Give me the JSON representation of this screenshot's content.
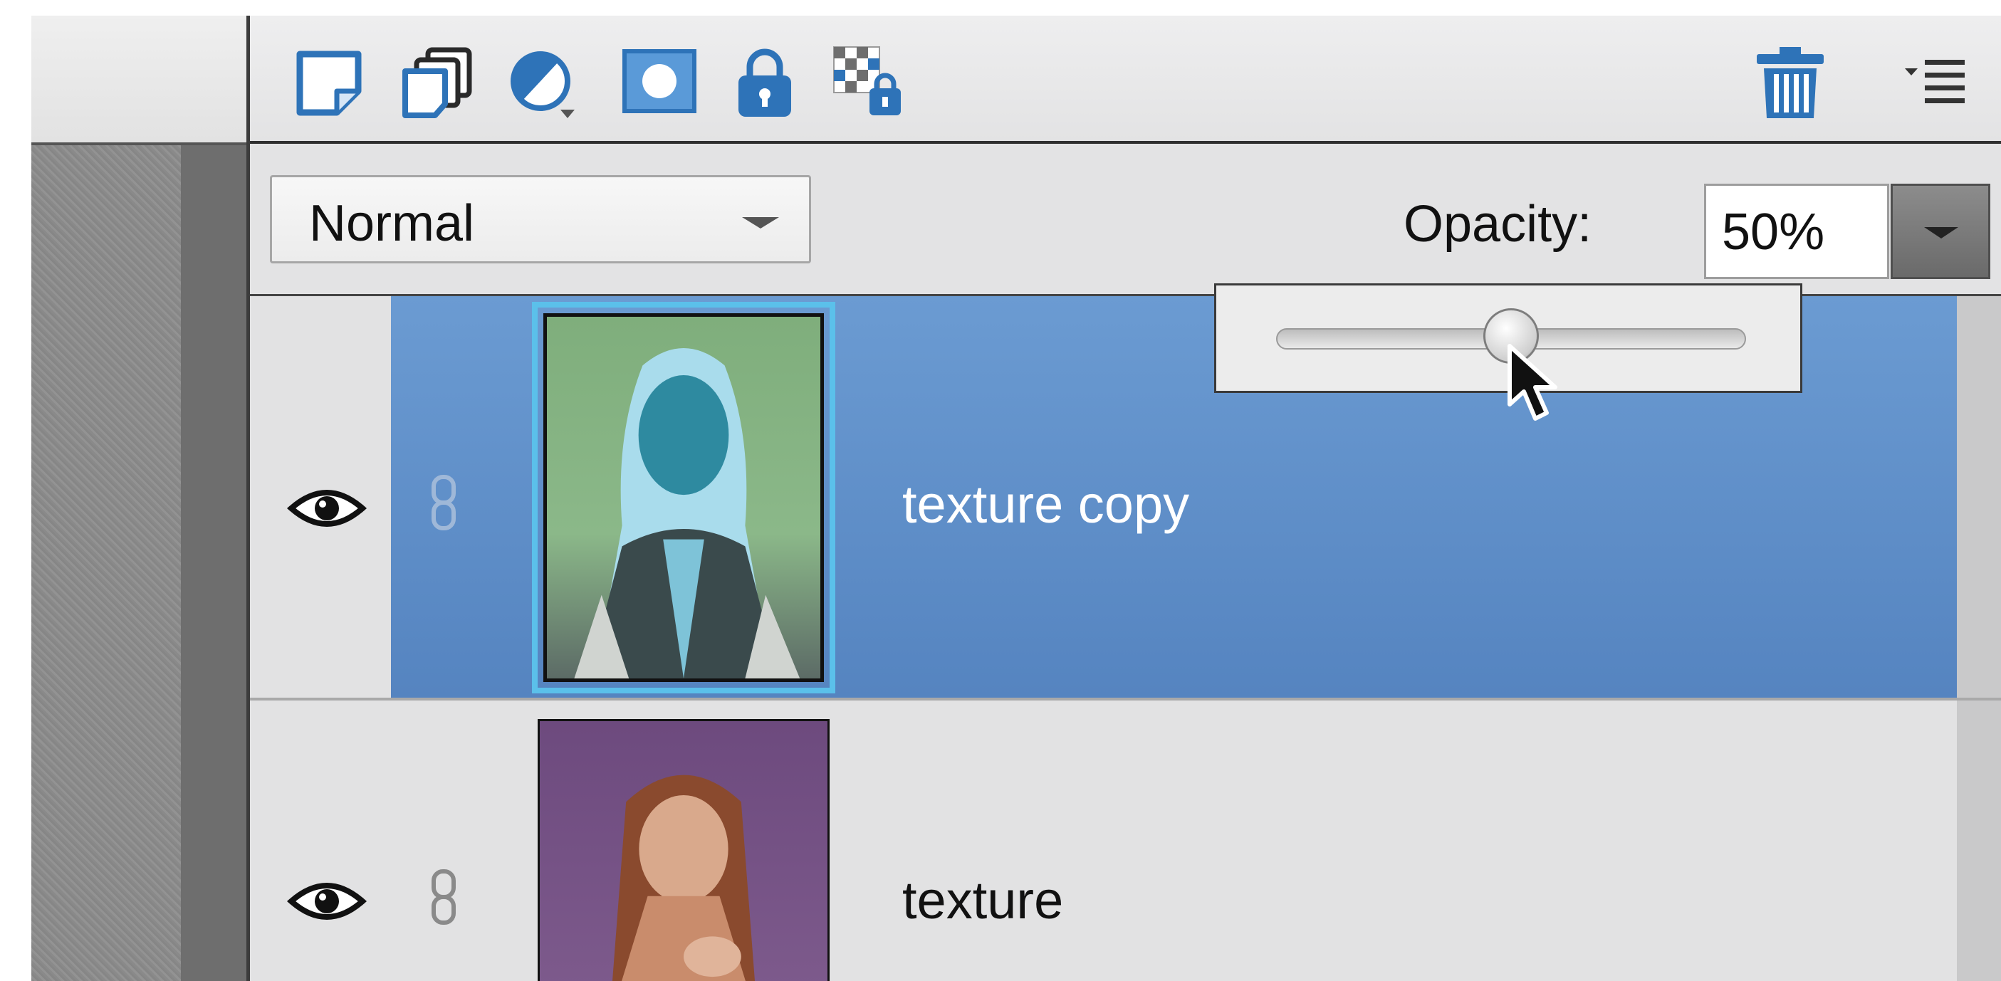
{
  "toolbar": {
    "icons": [
      "new-layer-icon",
      "new-group-icon",
      "adjustment-layer-icon",
      "layer-mask-icon",
      "lock-all-icon",
      "lock-transparency-icon",
      "trash-icon",
      "panel-menu-icon"
    ]
  },
  "blend": {
    "mode": "Normal",
    "opacity_label": "Opacity:",
    "opacity_value": "50%",
    "opacity_fraction": 0.5
  },
  "layers": [
    {
      "name": "texture copy",
      "selected": true,
      "visible": true
    },
    {
      "name": "texture",
      "selected": false,
      "visible": true
    }
  ],
  "colors": {
    "selection": "#5b8ccb",
    "thumb_highlight": "#5bc0ea",
    "icon_blue": "#2e73b8"
  }
}
